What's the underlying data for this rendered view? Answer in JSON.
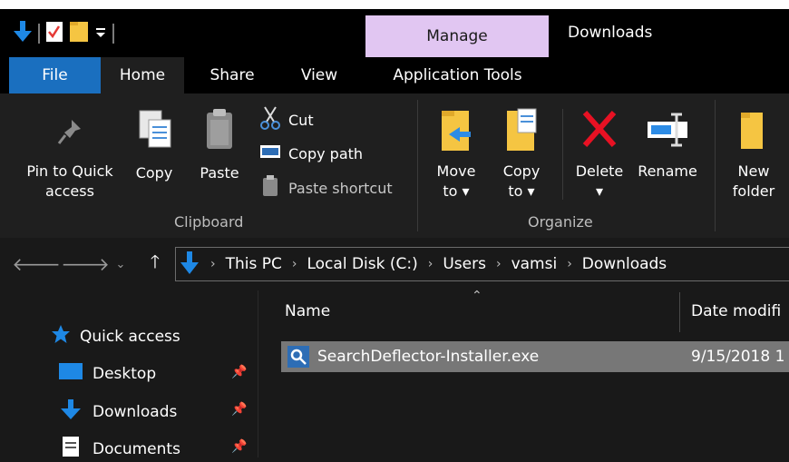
{
  "window": {
    "title": "Downloads",
    "contextual_tab": "Manage"
  },
  "tabs": {
    "file": "File",
    "home": "Home",
    "share": "Share",
    "view": "View",
    "application_tools": "Application Tools"
  },
  "ribbon": {
    "clipboard": {
      "pin_label": "Pin to Quick\naccess",
      "copy_label": "Copy",
      "paste_label": "Paste",
      "cut_label": "Cut",
      "copy_path_label": "Copy path",
      "paste_shortcut_label": "Paste shortcut",
      "group_label": "Clipboard"
    },
    "organize": {
      "move_to_label": "Move\nto ▾",
      "copy_to_label": "Copy\nto ▾",
      "delete_label": "Delete\n▾",
      "rename_label": "Rename",
      "group_label": "Organize"
    },
    "new": {
      "new_folder_label": "New\nfolder"
    }
  },
  "address_bar": {
    "crumbs": [
      "This PC",
      "Local Disk (C:)",
      "Users",
      "vamsi",
      "Downloads"
    ]
  },
  "sidebar": {
    "items": [
      {
        "label": "Quick access",
        "icon": "star-icon"
      },
      {
        "label": "Desktop",
        "icon": "desktop-icon"
      },
      {
        "label": "Downloads",
        "icon": "download-arrow-icon"
      },
      {
        "label": "Documents",
        "icon": "document-icon"
      }
    ]
  },
  "file_list": {
    "columns": {
      "name": "Name",
      "date_modified": "Date modifi"
    },
    "rows": [
      {
        "name": "SearchDeflector-Installer.exe",
        "date": "9/15/2018 1"
      }
    ]
  },
  "colors": {
    "file_tab": "#1a6fbf",
    "manage_tab": "#e1c6f2",
    "accent_blue": "#1e88e5",
    "folder_yellow": "#f5c542",
    "delete_red": "#e81123",
    "selected_row": "#777777"
  }
}
